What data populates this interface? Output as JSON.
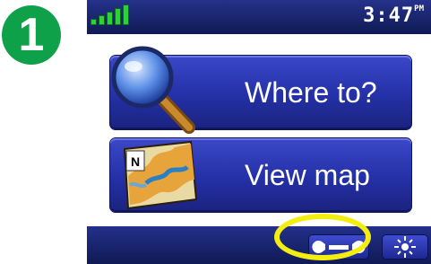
{
  "step": {
    "number": "1",
    "color": "#0fa14a"
  },
  "status_bar": {
    "signal_icon": "signal-strength-icon",
    "time": "3:47",
    "ampm": "PM"
  },
  "menu": {
    "items": [
      {
        "label": "Where to?",
        "icon": "magnifier-icon"
      },
      {
        "label": "View map",
        "icon": "map-icon"
      }
    ]
  },
  "bottom_bar": {
    "buttons": [
      {
        "icon": "wrench-icon",
        "highlighted": true
      },
      {
        "icon": "brightness-icon",
        "highlighted": false
      }
    ]
  },
  "colors": {
    "button_blue": "#2430a6",
    "bar_blue": "#1e2a73",
    "highlight_yellow": "#f4ee10"
  }
}
